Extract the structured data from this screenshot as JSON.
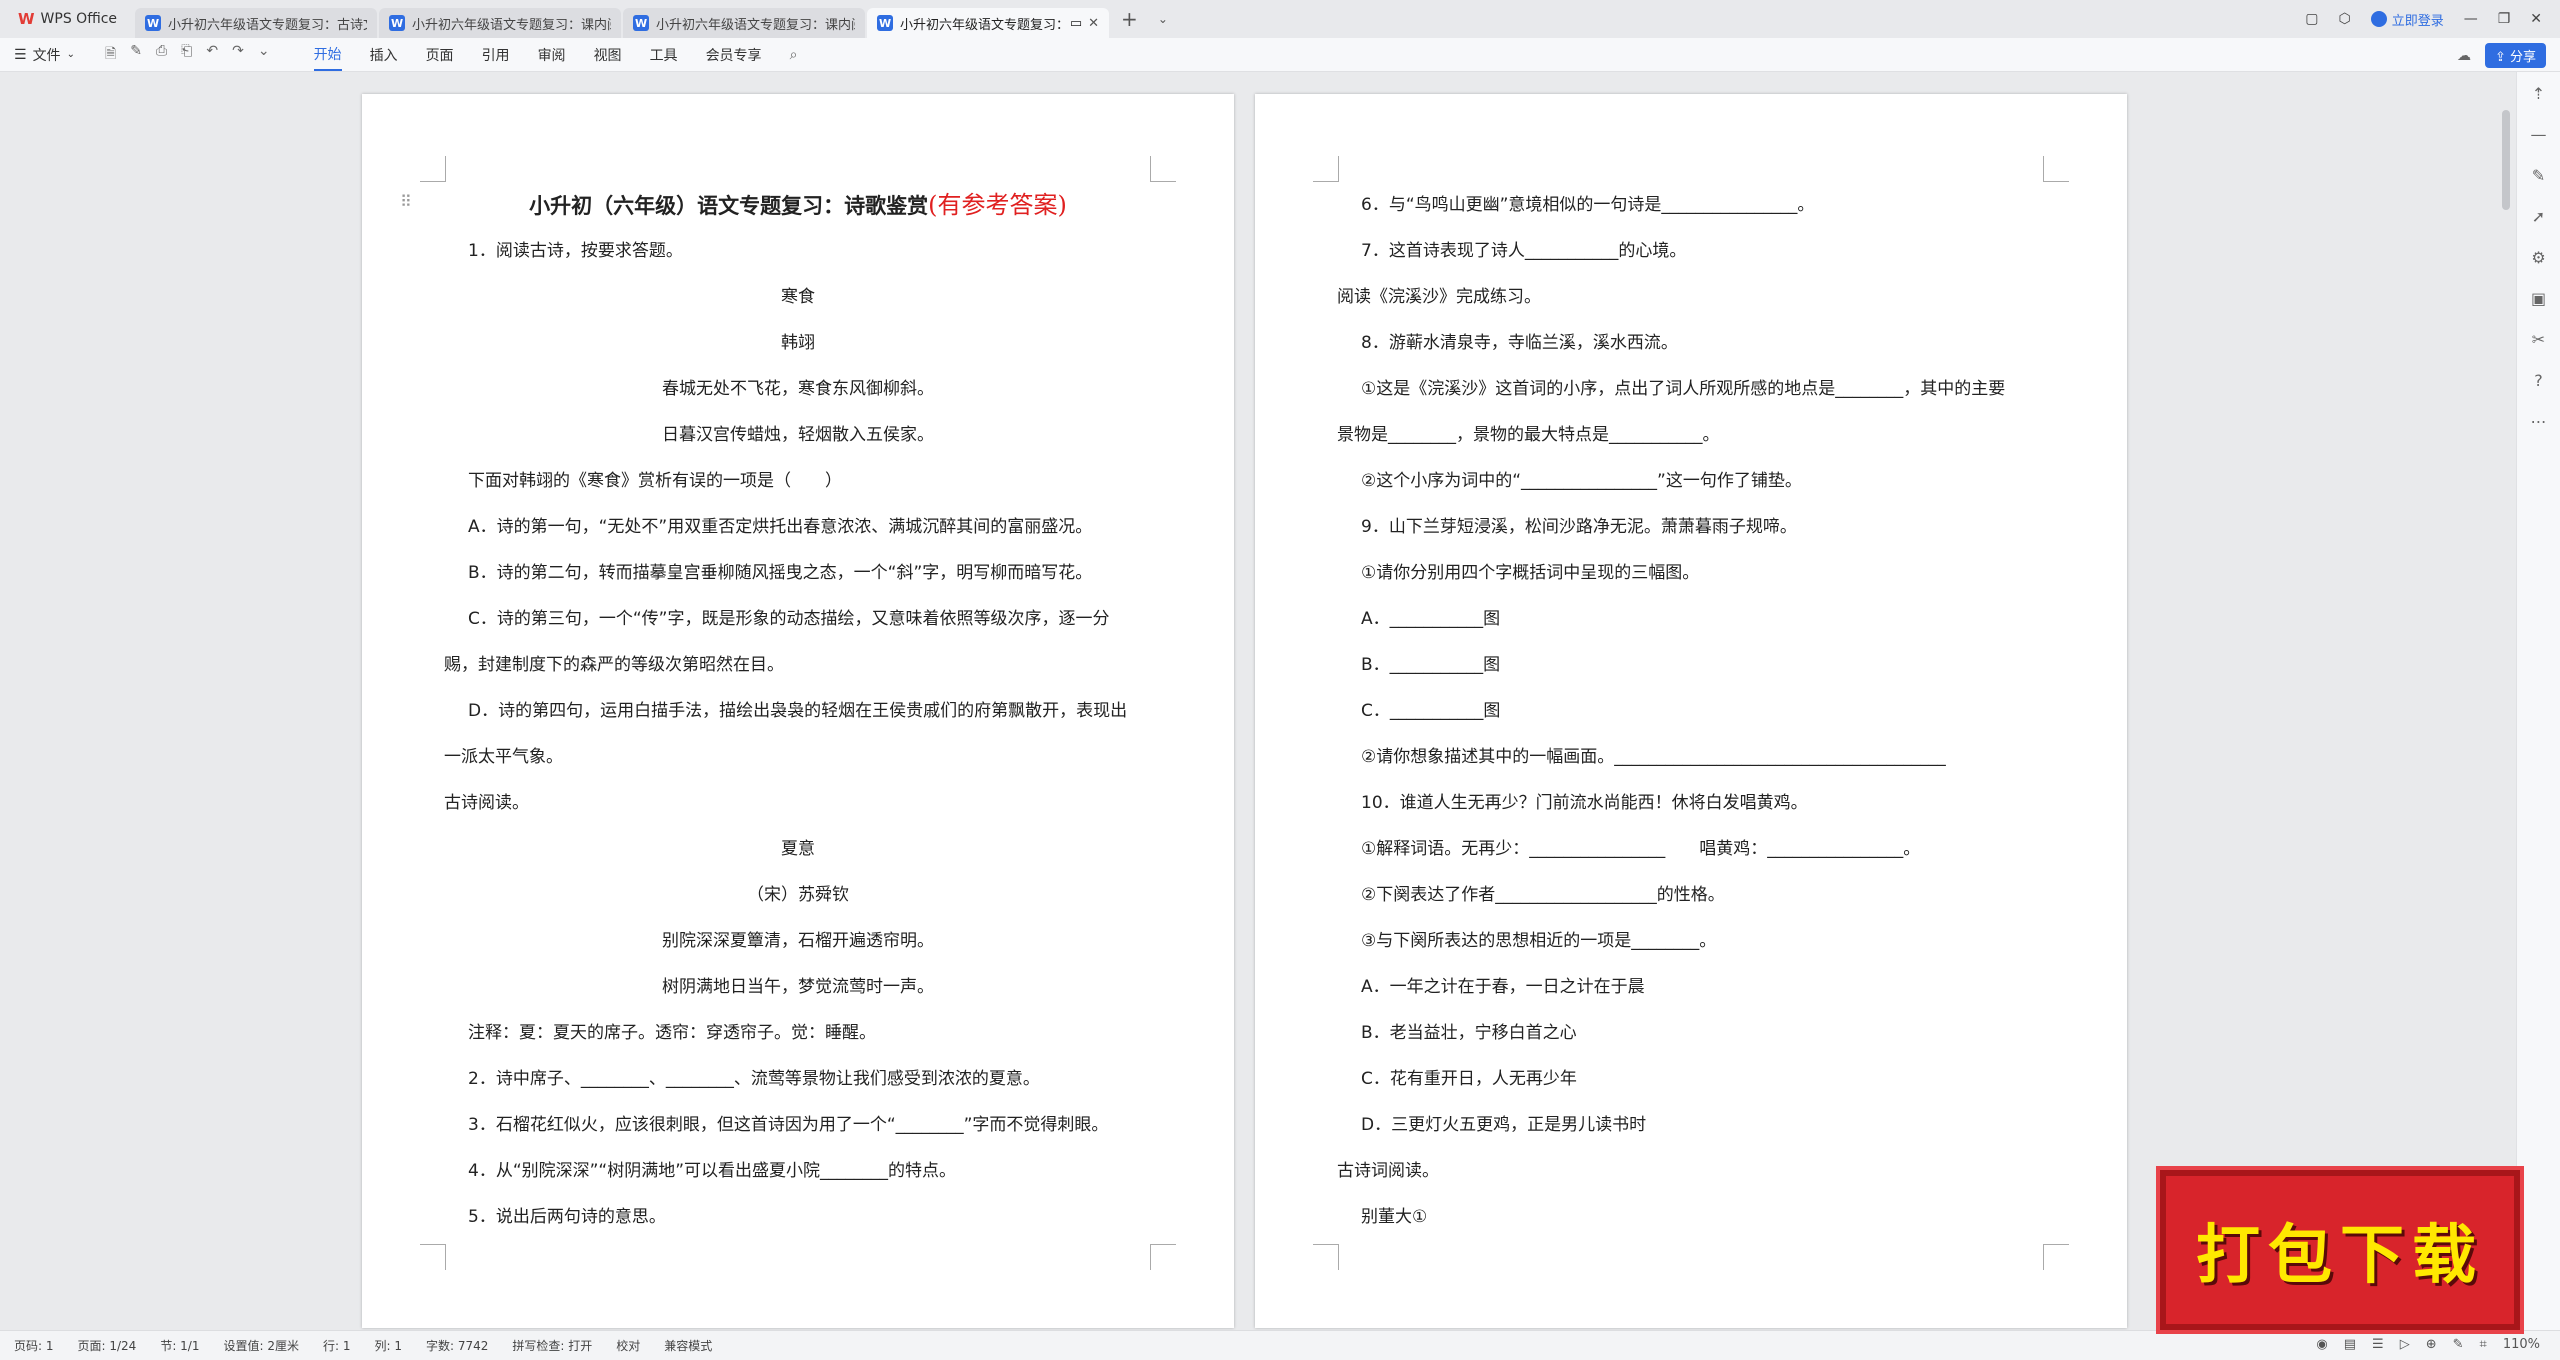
{
  "tabs": {
    "home": "WPS Office",
    "docs": [
      {
        "title": "小升初六年级语文专题复习：古诗文"
      },
      {
        "title": "小升初六年级语文专题复习：课内阅"
      },
      {
        "title": "小升初六年级语文专题复习：课内阅"
      },
      {
        "title": "小升初六年级语文专题复习："
      }
    ],
    "login": "立即登录"
  },
  "ribbon": {
    "file": "文件",
    "tabs": [
      "开始",
      "插入",
      "页面",
      "引用",
      "审阅",
      "视图",
      "工具",
      "会员专享"
    ],
    "share": "分享"
  },
  "page_left": {
    "title_black": "小升初（六年级）语文专题复习：诗歌鉴赏",
    "title_red": "(有参考答案)",
    "lines": [
      {
        "text": "1．阅读古诗，按要求答题。",
        "style": "indent"
      },
      {
        "text": "寒食",
        "style": "center"
      },
      {
        "text": "韩翊",
        "style": "center"
      },
      {
        "text": "春城无处不飞花，寒食东风御柳斜。",
        "style": "center"
      },
      {
        "text": "日暮汉宫传蜡烛，轻烟散入五侯家。",
        "style": "center"
      },
      {
        "text": "下面对韩翊的《寒食》赏析有误的一项是（　　）",
        "style": "indent"
      },
      {
        "text": "A．诗的第一句，“无处不”用双重否定烘托出春意浓浓、满城沉醉其间的富丽盛况。",
        "style": "indent"
      },
      {
        "text": "B．诗的第二句，转而描摹皇宫垂柳随风摇曳之态，一个“斜”字，明写柳而暗写花。",
        "style": "indent"
      },
      {
        "text": "C．诗的第三句，一个“传”字，既是形象的动态描绘，又意味着依照等级次序，逐一分",
        "style": "indent"
      },
      {
        "text": "赐，封建制度下的森严的等级次第昭然在目。",
        "style": ""
      },
      {
        "text": "D．诗的第四句，运用白描手法，描绘出袅袅的轻烟在王侯贵戚们的府第飘散开，表现出",
        "style": "indent"
      },
      {
        "text": "一派太平气象。",
        "style": ""
      },
      {
        "text": "古诗阅读。",
        "style": ""
      },
      {
        "text": "夏意",
        "style": "center"
      },
      {
        "text": "（宋）苏舜钦",
        "style": "center"
      },
      {
        "text": "别院深深夏簟清，石榴开遍透帘明。",
        "style": "center"
      },
      {
        "text": "树阴满地日当午，梦觉流莺时一声。",
        "style": "center"
      },
      {
        "text": "注释：夏：夏天的席子。透帘：穿透帘子。觉：睡醒。",
        "style": "indent"
      },
      {
        "text": "2．诗中席子、________、________、流莺等景物让我们感受到浓浓的夏意。",
        "style": "indent"
      },
      {
        "text": "3．石榴花红似火，应该很刺眼，但这首诗因为用了一个“________”字而不觉得刺眼。",
        "style": "indent"
      },
      {
        "text": "4．从“别院深深”“树阴满地”可以看出盛夏小院________的特点。",
        "style": "indent"
      },
      {
        "text": "5．说出后两句诗的意思。",
        "style": "indent"
      }
    ]
  },
  "page_right": {
    "lines": [
      {
        "text": "6．与“鸟鸣山更幽”意境相似的一句诗是________________。",
        "style": "indent"
      },
      {
        "text": "7．这首诗表现了诗人___________的心境。",
        "style": "indent"
      },
      {
        "text": "阅读《浣溪沙》完成练习。",
        "style": ""
      },
      {
        "text": "8．游蕲水清泉寺，寺临兰溪，溪水西流。",
        "style": "indent"
      },
      {
        "text": "①这是《浣溪沙》这首词的小序，点出了词人所观所感的地点是________，其中的主要",
        "style": "indent"
      },
      {
        "text": "景物是________，景物的最大特点是___________。",
        "style": ""
      },
      {
        "text": "②这个小序为词中的“________________”这一句作了铺垫。",
        "style": "indent"
      },
      {
        "text": "9．山下兰芽短浸溪，松间沙路净无泥。萧萧暮雨子规啼。",
        "style": "indent"
      },
      {
        "text": "①请你分别用四个字概括词中呈现的三幅图。",
        "style": "indent"
      },
      {
        "text": "A．___________图",
        "style": "indent"
      },
      {
        "text": "B．___________图",
        "style": "indent"
      },
      {
        "text": "C．___________图",
        "style": "indent"
      },
      {
        "text": "②请你想象描述其中的一幅画面。_______________________________________",
        "style": "indent"
      },
      {
        "text": "10．谁道人生无再少？门前流水尚能西！休将白发唱黄鸡。",
        "style": "indent"
      },
      {
        "text": "①解释词语。无再少：________________　　唱黄鸡：________________。",
        "style": "indent"
      },
      {
        "text": "②下阕表达了作者___________________的性格。",
        "style": "indent"
      },
      {
        "text": "③与下阕所表达的思想相近的一项是________。",
        "style": "indent"
      },
      {
        "text": "A．一年之计在于春，一日之计在于晨",
        "style": "indent"
      },
      {
        "text": "B．老当益壮，宁移白首之心",
        "style": "indent"
      },
      {
        "text": "C．花有重开日，人无再少年",
        "style": "indent"
      },
      {
        "text": "D．三更灯火五更鸡，正是男儿读书时",
        "style": "indent"
      },
      {
        "text": "古诗词阅读。",
        "style": ""
      },
      {
        "text": "别董大①",
        "style": "indent"
      }
    ]
  },
  "status": {
    "items": [
      "页码: 1",
      "页面: 1/24",
      "节: 1/1",
      "设置值: 2厘米",
      "行: 1",
      "列: 1",
      "字数: 7742",
      "拼写检查: 打开",
      "校对",
      "兼容模式"
    ],
    "zoom": "110%"
  },
  "banner": "打包下载"
}
